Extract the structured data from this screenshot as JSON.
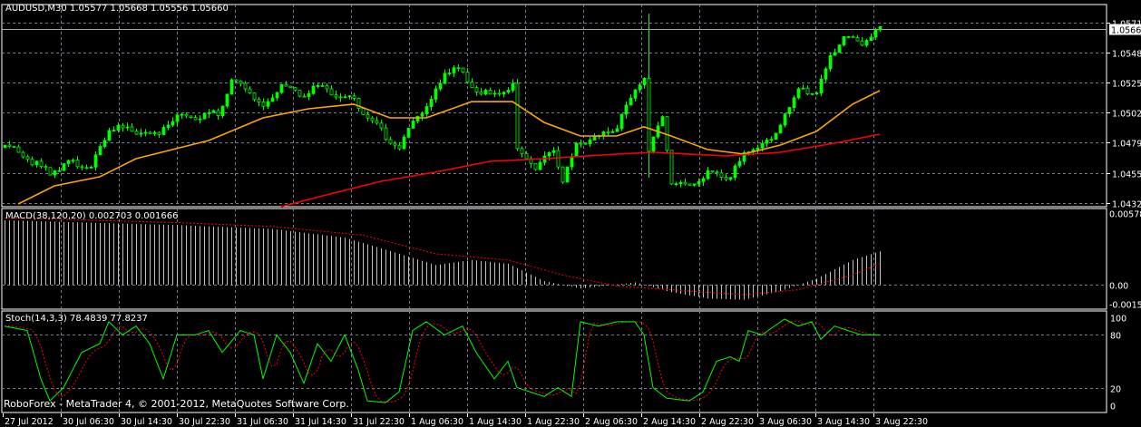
{
  "header": {
    "title": "AUDUSD,M30  1.05577 1.05668 1.05556 1.05660"
  },
  "macd_label": "MACD(38,120,20) 0.002703 0.001666",
  "stoch_label": "Stoch(14,3,3) 78.4839 77.8237",
  "copyright": "RoboForex - MetaTrader 4, © 2001-2012, MetaQuotes Software Corp.",
  "colors": {
    "background": "#000000",
    "candle": "#00ff00",
    "grid": "#708090",
    "ma_fast": "#ffa500",
    "ma_slow": "#ff0000",
    "macd_hist": "#c0c0c0",
    "signal": "#ff0000",
    "stoch_main": "#00ff00",
    "stoch_signal": "#ff0000"
  },
  "chart_data": [
    {
      "type": "candlestick",
      "title": "AUDUSD,M30",
      "current_price": "1.05660",
      "ylim": [
        1.04325,
        1.0571
      ],
      "y_ticks": [
        "1.05710",
        "1.05480",
        "1.05250",
        "1.05020",
        "1.04790",
        "1.04555",
        "1.04325"
      ],
      "bars": 194,
      "close_anchors": [
        [
          0,
          1.0477
        ],
        [
          5,
          1.04666
        ],
        [
          10,
          1.04562
        ],
        [
          15,
          1.04645
        ],
        [
          19,
          1.04596
        ],
        [
          23,
          1.0491
        ],
        [
          29,
          1.04875
        ],
        [
          33,
          1.0484
        ],
        [
          37,
          1.04979
        ],
        [
          43,
          1.04993
        ],
        [
          47,
          1.05014
        ],
        [
          50,
          1.05258
        ],
        [
          54,
          1.05188
        ],
        [
          57,
          1.05049
        ],
        [
          61,
          1.05244
        ],
        [
          65,
          1.05153
        ],
        [
          69,
          1.05223
        ],
        [
          73,
          1.05153
        ],
        [
          77,
          1.05118
        ],
        [
          81,
          1.04944
        ],
        [
          85,
          1.04805
        ],
        [
          87,
          1.04736
        ],
        [
          90,
          1.04979
        ],
        [
          93,
          1.05049
        ],
        [
          97,
          1.05327
        ],
        [
          100,
          1.05341
        ],
        [
          103,
          1.05223
        ],
        [
          107,
          1.05153
        ],
        [
          112,
          1.05223
        ],
        [
          113,
          1.04736
        ],
        [
          117,
          1.04596
        ],
        [
          121,
          1.04736
        ],
        [
          123,
          1.04492
        ],
        [
          126,
          1.0477
        ],
        [
          131,
          1.0484
        ],
        [
          135,
          1.0491
        ],
        [
          139,
          1.05188
        ],
        [
          141,
          1.05292
        ],
        [
          142,
          1.04736
        ],
        [
          145,
          1.04979
        ],
        [
          147,
          1.04492
        ],
        [
          151,
          1.04457
        ],
        [
          155,
          1.04562
        ],
        [
          160,
          1.04527
        ],
        [
          163,
          1.04701
        ],
        [
          169,
          1.04805
        ],
        [
          172,
          1.05014
        ],
        [
          175,
          1.05188
        ],
        [
          179,
          1.05188
        ],
        [
          182,
          1.05432
        ],
        [
          185,
          1.05606
        ],
        [
          189,
          1.0555
        ],
        [
          193,
          1.0566
        ]
      ],
      "spikes": [
        {
          "bar": 142,
          "high": 1.0578,
          "low": 1.0452
        }
      ],
      "ma_fast": [
        [
          3,
          1.04318
        ],
        [
          11,
          1.04457
        ],
        [
          21,
          1.04527
        ],
        [
          29,
          1.04666
        ],
        [
          45,
          1.04805
        ],
        [
          57,
          1.04979
        ],
        [
          67,
          1.05049
        ],
        [
          77,
          1.05084
        ],
        [
          85,
          1.04979
        ],
        [
          93,
          1.04979
        ],
        [
          103,
          1.05104
        ],
        [
          112,
          1.05104
        ],
        [
          119,
          1.04944
        ],
        [
          127,
          1.0484
        ],
        [
          135,
          1.0484
        ],
        [
          141,
          1.0491
        ],
        [
          147,
          1.0484
        ],
        [
          155,
          1.04736
        ],
        [
          163,
          1.04701
        ],
        [
          171,
          1.0477
        ],
        [
          179,
          1.04875
        ],
        [
          187,
          1.05084
        ],
        [
          193,
          1.05188
        ]
      ],
      "ma_slow": [
        [
          61,
          1.04297
        ],
        [
          71,
          1.04388
        ],
        [
          83,
          1.04492
        ],
        [
          95,
          1.04562
        ],
        [
          107,
          1.04645
        ],
        [
          119,
          1.04666
        ],
        [
          135,
          1.04701
        ],
        [
          143,
          1.04715
        ],
        [
          159,
          1.04687
        ],
        [
          171,
          1.04715
        ],
        [
          183,
          1.04784
        ],
        [
          193,
          1.04854
        ]
      ]
    },
    {
      "type": "bar",
      "title": "MACD(38,120,20)",
      "ylim": [
        -0.00152,
        0.00578
      ],
      "y_ticks": [
        "0.00578",
        "0.00",
        "-0.00152"
      ],
      "main": [
        [
          0,
          0.0052
        ],
        [
          19,
          0.005
        ],
        [
          39,
          0.0048
        ],
        [
          59,
          0.0045
        ],
        [
          75,
          0.0038
        ],
        [
          87,
          0.0025
        ],
        [
          95,
          0.0016
        ],
        [
          103,
          0.002
        ],
        [
          111,
          0.0017
        ],
        [
          119,
          0.0003
        ],
        [
          127,
          -0.0003
        ],
        [
          139,
          0.0002
        ],
        [
          147,
          -0.0006
        ],
        [
          155,
          -0.0011
        ],
        [
          163,
          -0.0012
        ],
        [
          171,
          -0.0005
        ],
        [
          179,
          0.0005
        ],
        [
          187,
          0.002
        ],
        [
          193,
          0.0027
        ]
      ],
      "signal": [
        [
          0,
          0.0054
        ],
        [
          39,
          0.005
        ],
        [
          59,
          0.0047
        ],
        [
          79,
          0.004
        ],
        [
          95,
          0.0025
        ],
        [
          111,
          0.002
        ],
        [
          123,
          0.0008
        ],
        [
          135,
          -0.0001
        ],
        [
          151,
          -0.0005
        ],
        [
          163,
          -0.0008
        ],
        [
          175,
          -0.0004
        ],
        [
          187,
          0.0008
        ],
        [
          193,
          0.0017
        ]
      ]
    },
    {
      "type": "line",
      "title": "Stoch(14,3,3)",
      "ylim": [
        0,
        100
      ],
      "y_ticks": [
        "100",
        "80",
        "20",
        "0"
      ],
      "main": [
        [
          0,
          90
        ],
        [
          5,
          85
        ],
        [
          8,
          30
        ],
        [
          10,
          5
        ],
        [
          13,
          20
        ],
        [
          17,
          60
        ],
        [
          21,
          70
        ],
        [
          23,
          95
        ],
        [
          26,
          80
        ],
        [
          29,
          90
        ],
        [
          32,
          70
        ],
        [
          35,
          30
        ],
        [
          38,
          80
        ],
        [
          42,
          80
        ],
        [
          45,
          85
        ],
        [
          48,
          60
        ],
        [
          52,
          85
        ],
        [
          55,
          80
        ],
        [
          57,
          30
        ],
        [
          60,
          80
        ],
        [
          63,
          60
        ],
        [
          66,
          25
        ],
        [
          69,
          70
        ],
        [
          72,
          50
        ],
        [
          75,
          80
        ],
        [
          78,
          40
        ],
        [
          80,
          5
        ],
        [
          84,
          3
        ],
        [
          87,
          15
        ],
        [
          90,
          85
        ],
        [
          93,
          95
        ],
        [
          97,
          80
        ],
        [
          101,
          90
        ],
        [
          104,
          60
        ],
        [
          108,
          30
        ],
        [
          111,
          50
        ],
        [
          113,
          20
        ],
        [
          116,
          15
        ],
        [
          119,
          10
        ],
        [
          122,
          20
        ],
        [
          125,
          10
        ],
        [
          127,
          95
        ],
        [
          131,
          90
        ],
        [
          135,
          95
        ],
        [
          139,
          95
        ],
        [
          141,
          80
        ],
        [
          143,
          20
        ],
        [
          146,
          8
        ],
        [
          151,
          5
        ],
        [
          154,
          15
        ],
        [
          157,
          50
        ],
        [
          160,
          55
        ],
        [
          162,
          50
        ],
        [
          164,
          85
        ],
        [
          167,
          80
        ],
        [
          172,
          98
        ],
        [
          175,
          90
        ],
        [
          178,
          95
        ],
        [
          180,
          75
        ],
        [
          183,
          90
        ],
        [
          186,
          85
        ],
        [
          189,
          80
        ],
        [
          193,
          80
        ]
      ]
    }
  ],
  "time_axis": [
    "27 Jul 2012",
    "30 Jul 06:30",
    "30 Jul 14:30",
    "30 Jul 22:30",
    "31 Jul 06:30",
    "31 Jul 14:30",
    "31 Jul 22:30",
    "1 Aug 06:30",
    "1 Aug 14:30",
    "1 Aug 22:30",
    "2 Aug 06:30",
    "2 Aug 14:30",
    "2 Aug 22:30",
    "3 Aug 06:30",
    "3 Aug 14:30",
    "3 Aug 22:30"
  ]
}
